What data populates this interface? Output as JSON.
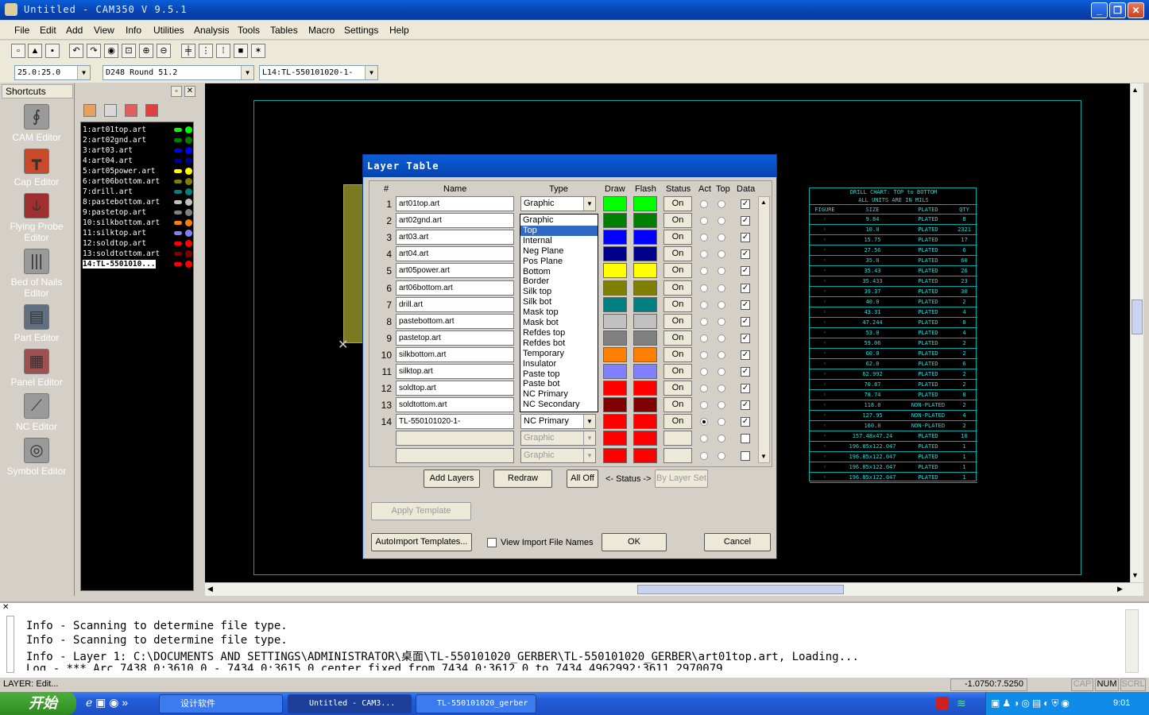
{
  "window": {
    "title": "Untitled - CAM350 V 9.5.1"
  },
  "menu": [
    "File",
    "Edit",
    "Add",
    "View",
    "Info",
    "Utilities",
    "Analysis",
    "Tools",
    "Tables",
    "Macro",
    "Settings",
    "Help"
  ],
  "combos": {
    "grid": "25.0:25.0",
    "dcode": "D248  Round 51.2",
    "layer": "L14:TL-550101020-1-"
  },
  "shortcuts": {
    "header": "Shortcuts",
    "items": [
      "CAM Editor",
      "Cap Editor",
      "Flying Probe Editor",
      "Bed of Nails Editor",
      "Part Editor",
      "Panel Editor",
      "NC Editor",
      "Symbol Editor"
    ]
  },
  "layers": [
    {
      "label": "1:art01top.art",
      "color": "#00ff00"
    },
    {
      "label": "2:art02gnd.art",
      "color": "#008000"
    },
    {
      "label": "3:art03.art",
      "color": "#0000ff"
    },
    {
      "label": "4:art04.art",
      "color": "#00008b"
    },
    {
      "label": "5:art05power.art",
      "color": "#ffff00"
    },
    {
      "label": "6:art06bottom.art",
      "color": "#808000"
    },
    {
      "label": "7:drill.art",
      "color": "#008080"
    },
    {
      "label": "8:pastebottom.art",
      "color": "#c0c0c0"
    },
    {
      "label": "9:pastetop.art",
      "color": "#808080"
    },
    {
      "label": "10:silkbottom.art",
      "color": "#ff8000"
    },
    {
      "label": "11:silktop.art",
      "color": "#8080ff"
    },
    {
      "label": "12:soldtop.art",
      "color": "#ff0000"
    },
    {
      "label": "13:soldtottom.art",
      "color": "#800000"
    },
    {
      "label": "14:TL-5501010...",
      "color": "#ff0000"
    }
  ],
  "drill_chart": {
    "title": "DRILL CHART: TOP to BOTTOM",
    "subtitle": "ALL UNITS ARE IN MILS",
    "headers": [
      "FIGURE",
      "SIZE",
      "PLATED",
      "QTY"
    ],
    "rows": [
      [
        "9.84",
        "PLATED",
        "8"
      ],
      [
        "10.0",
        "PLATED",
        "2321"
      ],
      [
        "15.75",
        "PLATED",
        "17"
      ],
      [
        "27.56",
        "PLATED",
        "6"
      ],
      [
        "35.0",
        "PLATED",
        "60"
      ],
      [
        "35.43",
        "PLATED",
        "26"
      ],
      [
        "35.433",
        "PLATED",
        "23"
      ],
      [
        "39.37",
        "PLATED",
        "30"
      ],
      [
        "40.0",
        "PLATED",
        "2"
      ],
      [
        "43.31",
        "PLATED",
        "4"
      ],
      [
        "47.244",
        "PLATED",
        "8"
      ],
      [
        "53.0",
        "PLATED",
        "4"
      ],
      [
        "59.06",
        "PLATED",
        "2"
      ],
      [
        "60.0",
        "PLATED",
        "2"
      ],
      [
        "62.0",
        "PLATED",
        "6"
      ],
      [
        "62.992",
        "PLATED",
        "2"
      ],
      [
        "70.87",
        "PLATED",
        "2"
      ],
      [
        "78.74",
        "PLATED",
        "8"
      ],
      [
        "118.0",
        "NON-PLATED",
        "2"
      ],
      [
        "127.95",
        "NON-PLATED",
        "4"
      ],
      [
        "160.0",
        "NON-PLATED",
        "2"
      ],
      [
        "157.48x47.24",
        "PLATED",
        "10"
      ],
      [
        "196.85x122.047",
        "PLATED",
        "1"
      ],
      [
        "196.85x122.047",
        "PLATED",
        "1"
      ],
      [
        "196.85x122.047",
        "PLATED",
        "1"
      ],
      [
        "196.85x122.047",
        "PLATED",
        "1"
      ]
    ]
  },
  "dialog": {
    "title": "Layer Table",
    "headers": {
      "num": "#",
      "name": "Name",
      "type": "Type",
      "draw": "Draw",
      "flash": "Flash",
      "status": "Status",
      "act": "Act",
      "top": "Top",
      "data": "Data"
    },
    "rows": [
      {
        "num": "1",
        "name": "art01top.art",
        "type": "Graphic",
        "color": "#00ff00",
        "status": "On",
        "act": false,
        "data": true
      },
      {
        "num": "2",
        "name": "art02gnd.art",
        "type": "",
        "color": "#008000",
        "status": "On",
        "act": false,
        "data": true
      },
      {
        "num": "3",
        "name": "art03.art",
        "type": "",
        "color": "#0000ff",
        "status": "On",
        "act": false,
        "data": true
      },
      {
        "num": "4",
        "name": "art04.art",
        "type": "",
        "color": "#00008b",
        "status": "On",
        "act": false,
        "data": true
      },
      {
        "num": "5",
        "name": "art05power.art",
        "type": "",
        "color": "#ffff00",
        "status": "On",
        "act": false,
        "data": true
      },
      {
        "num": "6",
        "name": "art06bottom.art",
        "type": "",
        "color": "#808000",
        "status": "On",
        "act": false,
        "data": true
      },
      {
        "num": "7",
        "name": "drill.art",
        "type": "",
        "color": "#008080",
        "status": "On",
        "act": false,
        "data": true
      },
      {
        "num": "8",
        "name": "pastebottom.art",
        "type": "",
        "color": "#c0c0c0",
        "status": "On",
        "act": false,
        "data": true
      },
      {
        "num": "9",
        "name": "pastetop.art",
        "type": "",
        "color": "#808080",
        "status": "On",
        "act": false,
        "data": true
      },
      {
        "num": "10",
        "name": "silkbottom.art",
        "type": "",
        "color": "#ff8000",
        "status": "On",
        "act": false,
        "data": true
      },
      {
        "num": "11",
        "name": "silktop.art",
        "type": "",
        "color": "#8080ff",
        "status": "On",
        "act": false,
        "data": true
      },
      {
        "num": "12",
        "name": "soldtop.art",
        "type": "",
        "color": "#ff0000",
        "status": "On",
        "act": false,
        "data": true
      },
      {
        "num": "13",
        "name": "soldtottom.art",
        "type": "",
        "color": "#800000",
        "status": "On",
        "act": false,
        "data": true
      },
      {
        "num": "14",
        "name": "TL-550101020-1-",
        "type": "NC Primary",
        "color": "#ff0000",
        "status": "On",
        "act": true,
        "data": true
      },
      {
        "num": "",
        "name": "",
        "type": "Graphic",
        "color": "#ff0000",
        "status": "",
        "act": false,
        "data": false,
        "disabled": true
      },
      {
        "num": "",
        "name": "",
        "type": "Graphic",
        "color": "#ff0000",
        "status": "",
        "act": false,
        "data": false,
        "disabled": true
      }
    ],
    "type_options": [
      "Graphic",
      "Top",
      "Internal",
      "Neg Plane",
      "Pos Plane",
      "Bottom",
      "Border",
      "Silk top",
      "Silk bot",
      "Mask top",
      "Mask bot",
      "Refdes top",
      "Refdes bot",
      "Temporary",
      "Insulator",
      "Paste top",
      "Paste bot",
      "NC Primary",
      "NC Secondary"
    ],
    "type_selected": "Top",
    "buttons": {
      "add_layers": "Add Layers",
      "redraw": "Redraw",
      "all_off": "All Off",
      "status_label": "<- Status ->",
      "by_layer_set": "By Layer Set",
      "apply_template": "Apply Template",
      "autoimport": "AutoImport Templates...",
      "view_import": "View Import File Names",
      "ok": "OK",
      "cancel": "Cancel"
    }
  },
  "log": [
    "Info - Scanning to determine file type.",
    "Info - Scanning to determine file type.",
    "Info - Layer 1: C:\\DOCUMENTS AND SETTINGS\\ADMINISTRATOR\\桌面\\TL-550101020_GERBER\\TL-550101020_GERBER\\art01top.art, Loading...",
    "Log - *** Arc 7438.0:3610.0 - 7434.0:3615.0 center fixed from 7434.0:3612.0 to 7434.4962992:3611.2970079"
  ],
  "status": {
    "left": "LAYER: Edit...",
    "coords": "-1.0750:7.5250",
    "cap": "CAP",
    "num": "NUM",
    "scrl": "SCRL"
  },
  "taskbar": {
    "start": "开始",
    "tasks": [
      "设计软件",
      "Untitled - CAM3...",
      "TL-550101020_gerber"
    ],
    "time": "9:01"
  }
}
